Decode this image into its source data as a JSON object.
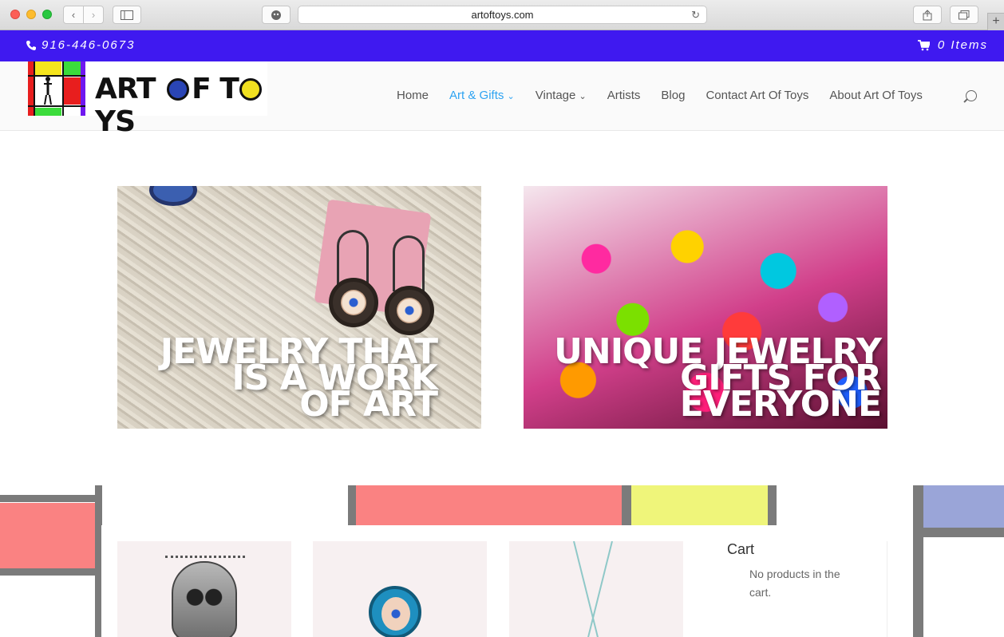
{
  "browser": {
    "url": "artoftoys.com"
  },
  "topbar": {
    "phone": "916-446-0673",
    "cart": "0 Items"
  },
  "header": {
    "logo_text_1": "ART",
    "logo_text_2": "F T",
    "logo_text_3": "YS",
    "nav": [
      "Home",
      "Art & Gifts",
      "Vintage",
      "Artists",
      "Blog",
      "Contact Art Of Toys",
      "About Art Of Toys"
    ]
  },
  "banners": [
    {
      "title": "JEWELRY THAT\nIS A WORK\nOF ART"
    },
    {
      "title": "UNIQUE JEWELRY\nGIFTS FOR\nEVERYONE"
    }
  ],
  "cart_widget": {
    "title": "Cart",
    "text": "No products in the cart."
  },
  "colors": {
    "topbar": "#3f19f0",
    "nav_active": "#2ea3f2",
    "mondrian_red": "#fa8282",
    "mondrian_yellow": "#eff57a",
    "mondrian_blue": "#9aa5d8"
  }
}
